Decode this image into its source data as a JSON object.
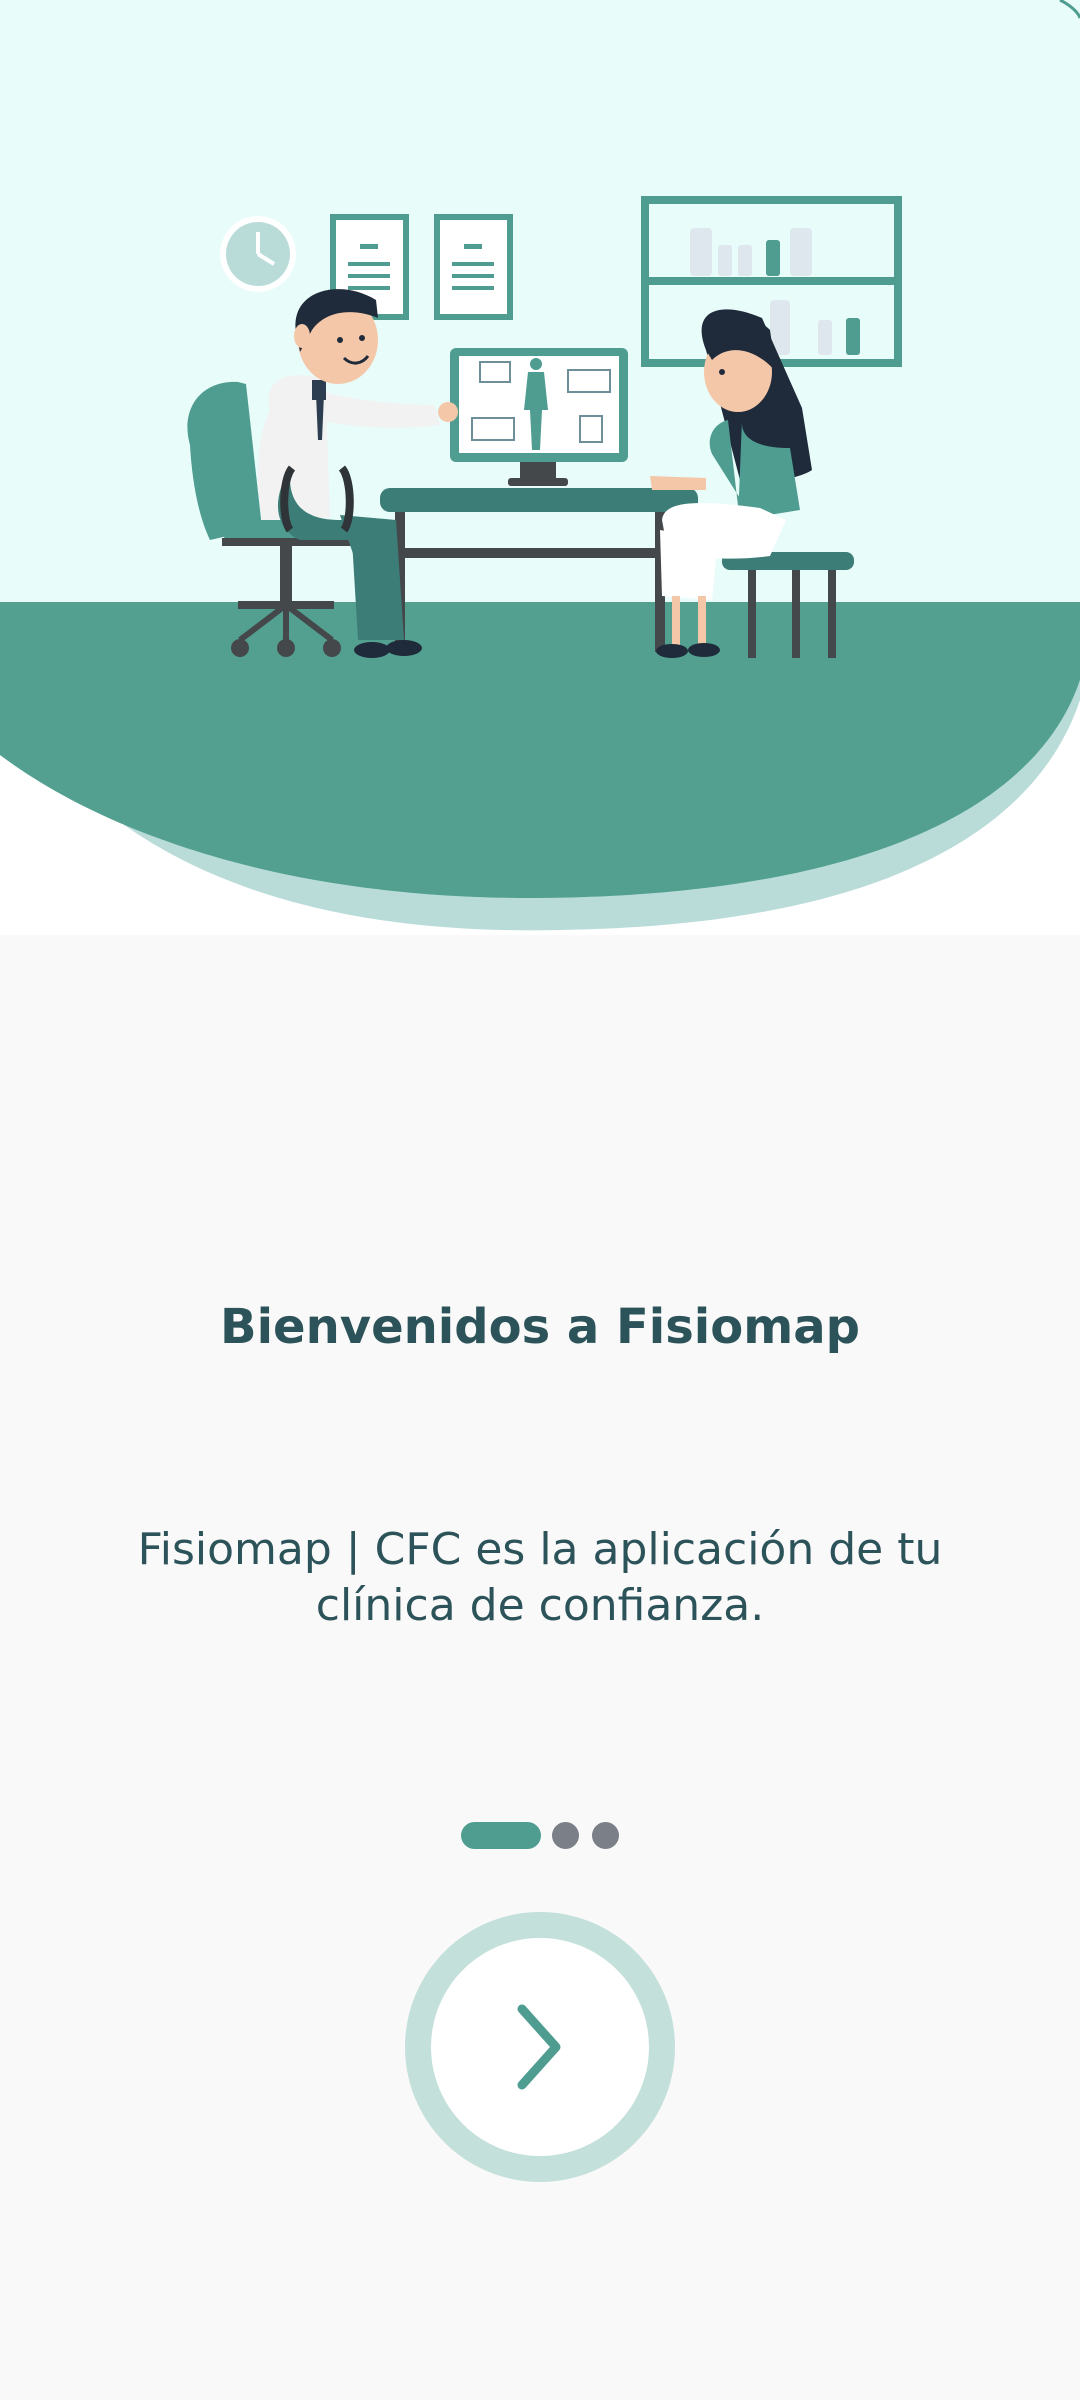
{
  "onboarding": {
    "illustration": {
      "name": "doctor-patient-consultation-illustration",
      "colors": {
        "background": "#e8fcfa",
        "floor": "#53a091",
        "accent_light": "#b9dcd9",
        "accent": "#4f9d91",
        "dark": "#45484b"
      }
    },
    "title": "Bienvenidos a Fisiomap",
    "description": "Fisiomap | CFC es la aplicación de tu clínica de confianza.",
    "pager": {
      "total": 3,
      "current": 1
    },
    "next_button": {
      "icon": "chevron-right-icon"
    }
  }
}
